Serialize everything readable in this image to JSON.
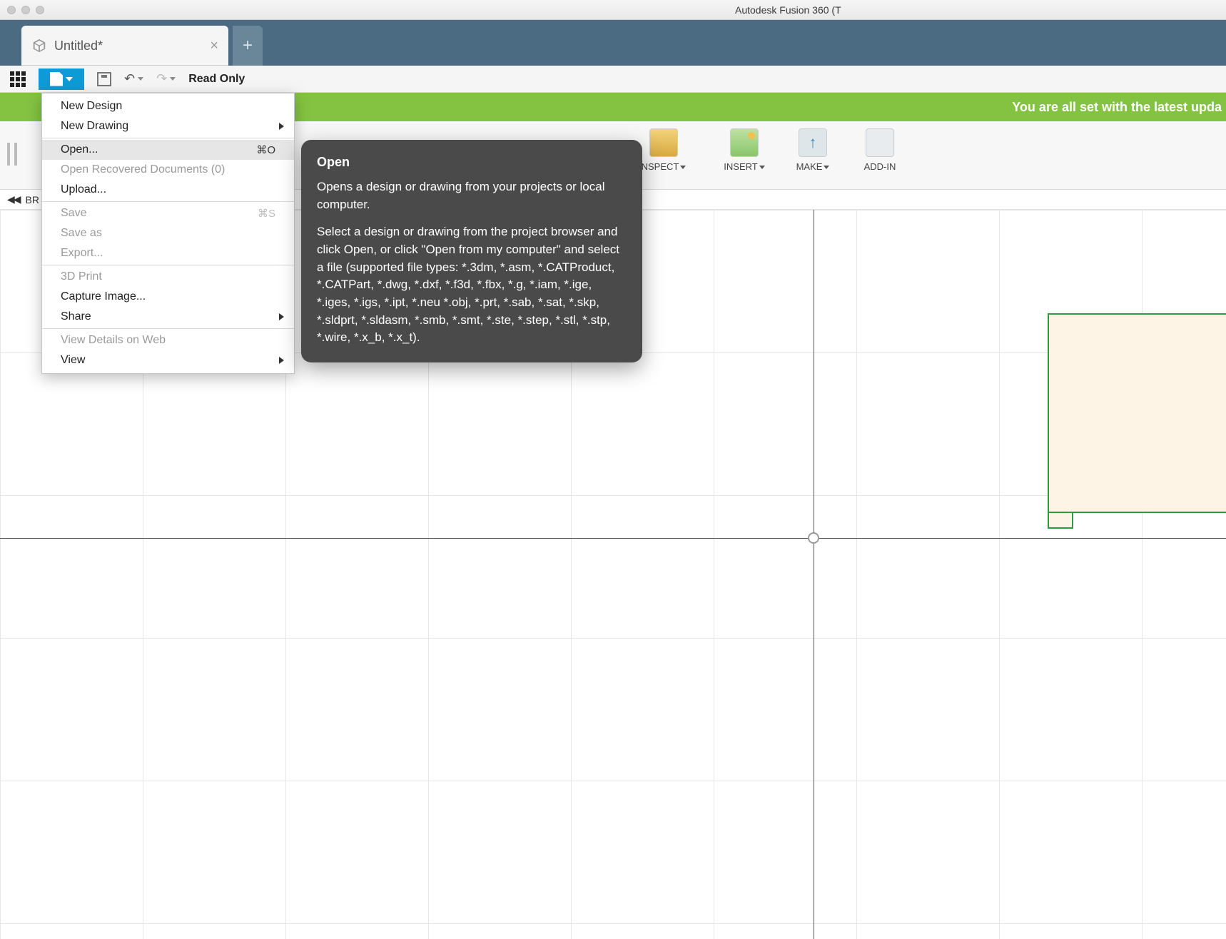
{
  "window": {
    "title": "Autodesk Fusion 360 (T"
  },
  "tab": {
    "label": "Untitled*"
  },
  "toolbar": {
    "read_only": "Read Only"
  },
  "banner": {
    "text": "You are all set with the latest upda"
  },
  "ribbon": {
    "inspect": "NSPECT",
    "insert": "INSERT",
    "make": "MAKE",
    "addins": "ADD-IN"
  },
  "crumb": {
    "label": "BR"
  },
  "file_menu": {
    "new_design": "New Design",
    "new_drawing": "New Drawing",
    "open": "Open...",
    "open_shortcut": "⌘O",
    "open_recovered": "Open Recovered Documents (0)",
    "upload": "Upload...",
    "save": "Save",
    "save_shortcut": "⌘S",
    "save_as": "Save as",
    "export": "Export...",
    "print3d": "3D Print",
    "capture": "Capture Image...",
    "share": "Share",
    "view_details": "View Details on Web",
    "view": "View"
  },
  "tooltip": {
    "title": "Open",
    "p1": "Opens a design or drawing from your projects or local computer.",
    "p2": "Select a design or drawing from the project browser and click Open, or click \"Open from my computer\" and select a file (supported file types: *.3dm, *.asm, *.CATProduct, *.CATPart, *.dwg, *.dxf, *.f3d, *.fbx, *.g, *.iam, *.ige, *.iges, *.igs, *.ipt, *.neu *.obj, *.prt, *.sab, *.sat, *.skp, *.sldprt, *.sldasm, *.smb, *.smt, *.ste, *.step, *.stl, *.stp, *.wire, *.x_b, *.x_t)."
  }
}
